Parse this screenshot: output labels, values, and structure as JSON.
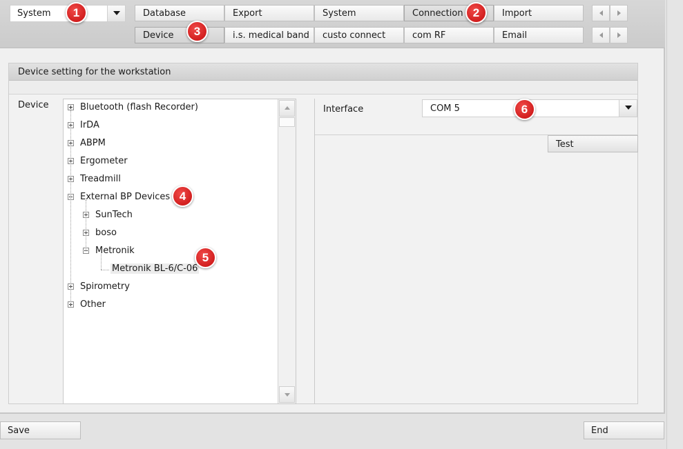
{
  "selector": {
    "value": "System"
  },
  "tabs_row1": [
    {
      "label": "Database"
    },
    {
      "label": "Export"
    },
    {
      "label": "System"
    },
    {
      "label": "Connection",
      "active": true
    },
    {
      "label": "Import"
    }
  ],
  "tabs_row2": [
    {
      "label": "Device",
      "active": true
    },
    {
      "label": "i.s. medical band"
    },
    {
      "label": "custo connect"
    },
    {
      "label": "com RF"
    },
    {
      "label": "Email"
    }
  ],
  "group": {
    "title": "Device setting for the workstation",
    "device_label": "Device"
  },
  "tree": [
    {
      "label": "Bluetooth (flash Recorder)",
      "level": 0,
      "expanded": false
    },
    {
      "label": "IrDA",
      "level": 0,
      "expanded": false
    },
    {
      "label": "ABPM",
      "level": 0,
      "expanded": false
    },
    {
      "label": "Ergometer",
      "level": 0,
      "expanded": false
    },
    {
      "label": "Treadmill",
      "level": 0,
      "expanded": false
    },
    {
      "label": "External BP Devices",
      "level": 0,
      "expanded": true
    },
    {
      "label": "SunTech",
      "level": 1,
      "expanded": false
    },
    {
      "label": "boso",
      "level": 1,
      "expanded": false
    },
    {
      "label": "Metronik",
      "level": 1,
      "expanded": true
    },
    {
      "label": "Metronik BL-6/C-06",
      "level": 2,
      "leaf": true,
      "selected": true
    },
    {
      "label": "Spirometry",
      "level": 0,
      "expanded": false
    },
    {
      "label": "Other",
      "level": 0,
      "expanded": false
    }
  ],
  "interface": {
    "label": "Interface",
    "value": "COM 5",
    "test_label": "Test"
  },
  "footer": {
    "save_label": "Save",
    "end_label": "End"
  },
  "badges": [
    "1",
    "2",
    "3",
    "4",
    "5",
    "6"
  ],
  "colors": {
    "badge": "#d9262a",
    "panel": "#f0f0f0",
    "header": "#d0d0d0"
  }
}
